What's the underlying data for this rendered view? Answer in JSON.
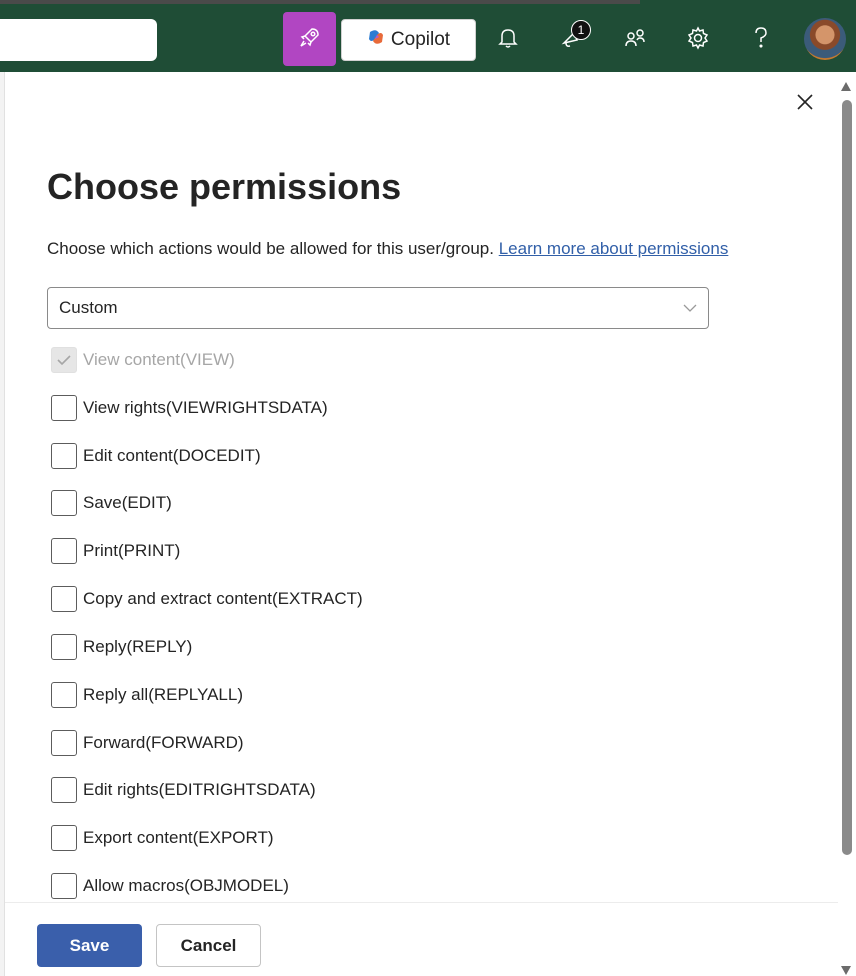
{
  "topbar": {
    "copilot_label": "Copilot",
    "notification_count": "1",
    "icons": [
      "rocket-icon",
      "copilot-logo-icon",
      "bell-icon",
      "megaphone-icon",
      "people-icon",
      "gear-icon",
      "help-icon",
      "avatar"
    ]
  },
  "dialog": {
    "title": "Choose permissions",
    "description": "Choose which actions would be allowed for this user/group.",
    "learn_more_link": "Learn more about permissions",
    "preset": {
      "selected": "Custom"
    },
    "permissions": [
      {
        "label": "View content(VIEW)",
        "checked": true,
        "disabled": true
      },
      {
        "label": "View rights(VIEWRIGHTSDATA)",
        "checked": false,
        "disabled": false
      },
      {
        "label": "Edit content(DOCEDIT)",
        "checked": false,
        "disabled": false
      },
      {
        "label": "Save(EDIT)",
        "checked": false,
        "disabled": false
      },
      {
        "label": "Print(PRINT)",
        "checked": false,
        "disabled": false
      },
      {
        "label": "Copy and extract content(EXTRACT)",
        "checked": false,
        "disabled": false
      },
      {
        "label": "Reply(REPLY)",
        "checked": false,
        "disabled": false
      },
      {
        "label": "Reply all(REPLYALL)",
        "checked": false,
        "disabled": false
      },
      {
        "label": "Forward(FORWARD)",
        "checked": false,
        "disabled": false
      },
      {
        "label": "Edit rights(EDITRIGHTSDATA)",
        "checked": false,
        "disabled": false
      },
      {
        "label": "Export content(EXPORT)",
        "checked": false,
        "disabled": false
      },
      {
        "label": "Allow macros(OBJMODEL)",
        "checked": false,
        "disabled": false
      }
    ],
    "save_label": "Save",
    "cancel_label": "Cancel"
  },
  "colors": {
    "topbar_bg": "#1f4d36",
    "rocket_button_bg": "#b146c2",
    "primary_button": "#3a5fab",
    "link": "#315fa8"
  }
}
